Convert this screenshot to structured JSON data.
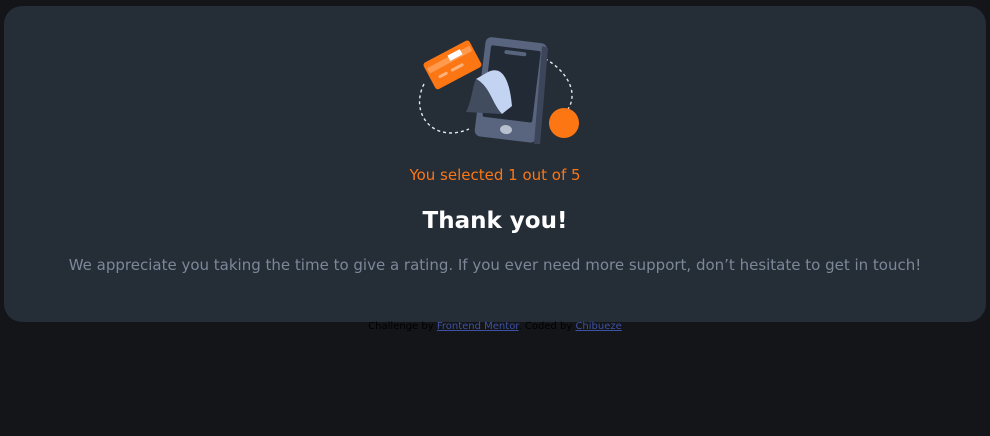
{
  "card": {
    "illustration_icon": "payment-phone-illustration",
    "selected_text": "You selected 1 out of 5",
    "title": "Thank you!",
    "message": "We appreciate you taking the time to give a rating. If you ever need more support, don’t hesitate to get in touch!"
  },
  "attribution": {
    "prefix": "Challenge by",
    "frontend_mentor_link": "Frontend Mentor",
    "separator": ". Coded by",
    "author_link": "Chibueze"
  },
  "colors": {
    "background": "#131518",
    "card": "#252d37",
    "accent_orange": "#fc7614",
    "muted_text": "#7c8798",
    "link": "#3e52a3"
  }
}
